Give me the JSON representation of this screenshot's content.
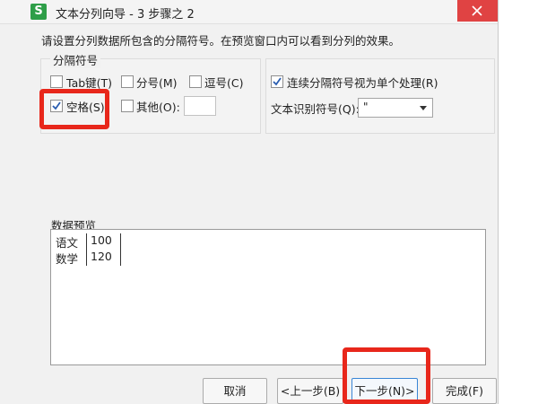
{
  "window": {
    "app_icon": "S",
    "title": "文本分列向导 - 3 步骤之 2"
  },
  "instruction": "请设置分列数据所包含的分隔符号。在预览窗口内可以看到分列的效果。",
  "delimiters": {
    "caption": "分隔符号",
    "tab": {
      "label": "Tab键(T)",
      "checked": false
    },
    "semicolon": {
      "label": "分号(M)",
      "checked": false
    },
    "comma": {
      "label": "逗号(C)",
      "checked": false
    },
    "space": {
      "label": "空格(S)",
      "checked": true
    },
    "other": {
      "label": "其他(O):",
      "checked": false,
      "value": ""
    }
  },
  "options": {
    "consecutive": {
      "label": "连续分隔符号视为单个处理(R)",
      "checked": true
    },
    "text_qualifier": {
      "label": "文本识别符号(Q):",
      "value": "\""
    }
  },
  "preview": {
    "caption": "数据预览",
    "rows": [
      [
        "语文",
        "100"
      ],
      [
        "数学",
        "120"
      ]
    ]
  },
  "buttons": {
    "cancel": "取消",
    "back": "<上一步(B)",
    "next": "下一步(N)>",
    "finish": "完成(F)"
  },
  "colors": {
    "highlight": "#e8271b",
    "close_button": "#e04343",
    "app_icon": "#2e9e48"
  }
}
